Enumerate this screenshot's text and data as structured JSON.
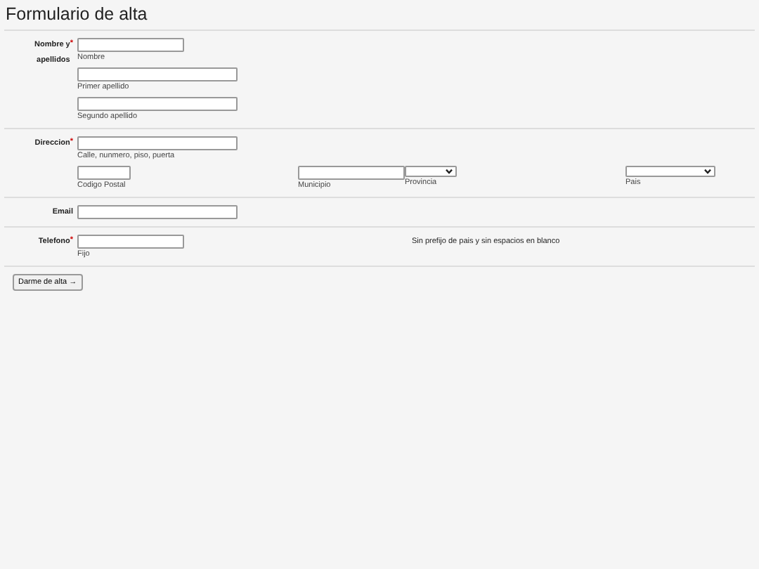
{
  "title": "Formulario de alta",
  "sections": [
    {
      "label": "Nombre y apellidos",
      "required_mark": "*",
      "groups": [
        [
          {
            "kind": "short-input",
            "caption": "Nombre"
          }
        ],
        [
          {
            "kind": "long-input",
            "caption": "Primer apellido"
          }
        ],
        [
          {
            "kind": "long-input",
            "caption": "Segundo apellido"
          }
        ]
      ]
    },
    {
      "label": "Direccion",
      "required_mark": "*",
      "groups": [
        [
          {
            "kind": "long-input",
            "caption": "Calle, nunmero, piso, puerta"
          }
        ],
        [
          {
            "kind": "tiny-input",
            "caption": "Codigo Postal"
          },
          {
            "kind": "short-input",
            "caption": "Municipio"
          },
          {
            "kind": "tiny-select",
            "caption": "Provincia"
          },
          {
            "kind": "short-select",
            "caption": "Pais"
          }
        ]
      ]
    },
    {
      "label": "Email",
      "groups": [
        [
          {
            "kind": "long-input"
          }
        ]
      ]
    },
    {
      "label": "Telefono",
      "required_mark": "*",
      "groups": [
        [
          {
            "kind": "short-input",
            "caption": "Fijo"
          }
        ]
      ],
      "note": "Sin prefijo de pais y sin espacios en blanco"
    }
  ],
  "submit": "Darme de alta →"
}
